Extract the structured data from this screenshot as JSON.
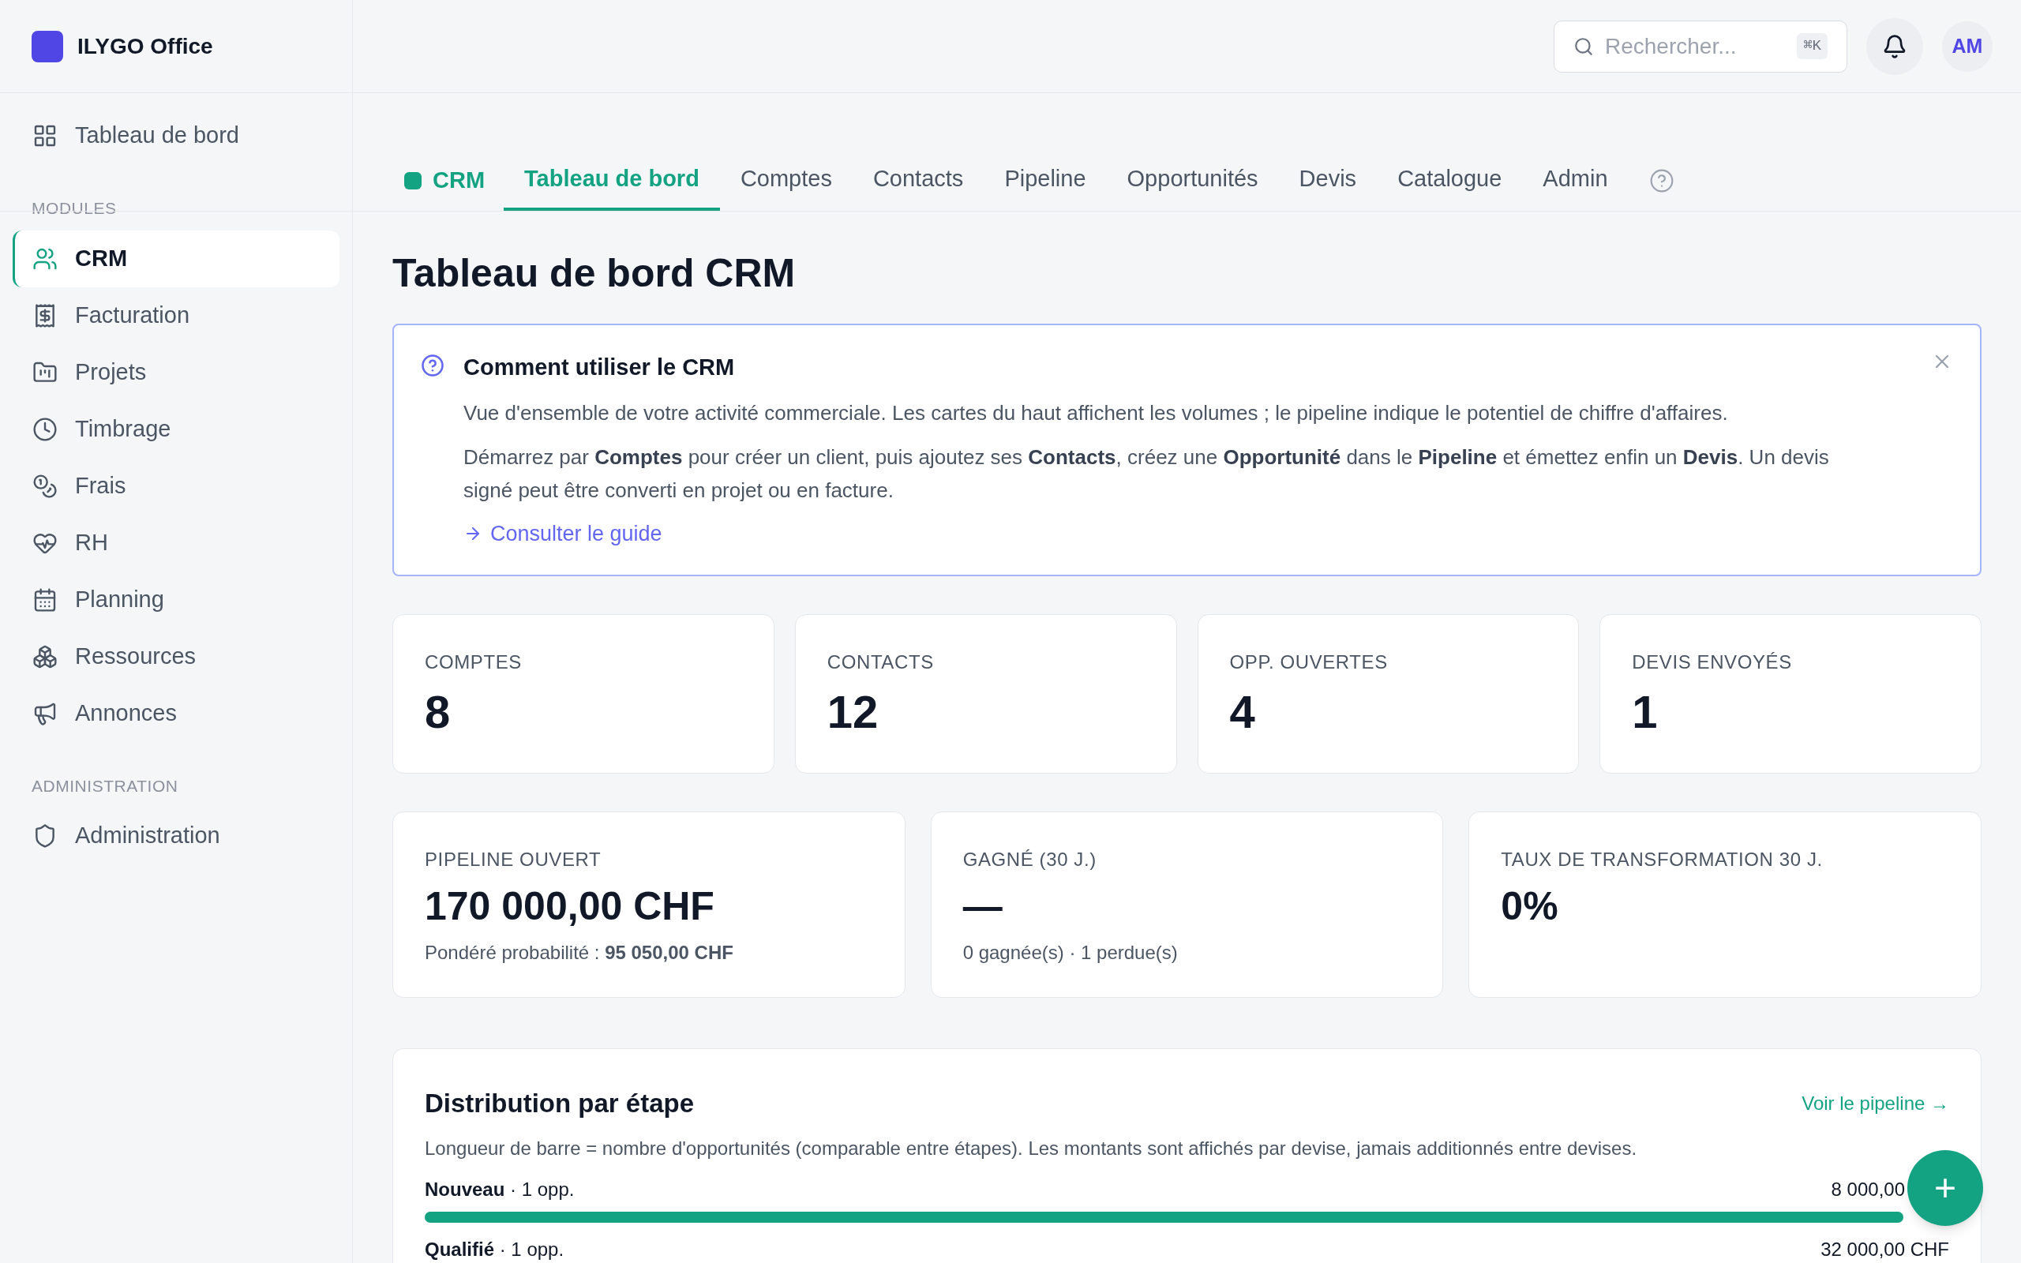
{
  "sidebar": {
    "brand": "ILYGO Office",
    "sections": [
      {
        "items": [
          {
            "label": "Tableau de bord",
            "selected": false
          }
        ]
      },
      {
        "label": "MODULES",
        "items": [
          {
            "label": "CRM",
            "selected": true
          },
          {
            "label": "Facturation",
            "selected": false
          },
          {
            "label": "Projets",
            "selected": false
          },
          {
            "label": "Timbrage",
            "selected": false
          },
          {
            "label": "Frais",
            "selected": false
          },
          {
            "label": "RH",
            "selected": false
          },
          {
            "label": "Planning",
            "selected": false
          },
          {
            "label": "Ressources",
            "selected": false
          },
          {
            "label": "Annonces",
            "selected": false
          }
        ]
      },
      {
        "label": "ADMINISTRATION",
        "items": [
          {
            "label": "Administration",
            "selected": false
          }
        ]
      }
    ]
  },
  "header": {
    "search": {
      "placeholder": "Rechercher...",
      "shortcut": "⌘K"
    },
    "avatar": "AM"
  },
  "module_tabs": {
    "module": "CRM",
    "tabs": [
      {
        "label": "Tableau de bord",
        "selected": true
      },
      {
        "label": "Comptes",
        "selected": false
      },
      {
        "label": "Contacts",
        "selected": false
      },
      {
        "label": "Pipeline",
        "selected": false
      },
      {
        "label": "Opportunités",
        "selected": false
      },
      {
        "label": "Devis",
        "selected": false
      },
      {
        "label": "Catalogue",
        "selected": false
      },
      {
        "label": "Admin",
        "selected": false
      }
    ]
  },
  "page_title": "Tableau de bord CRM",
  "info": {
    "title": "Comment utiliser le CRM",
    "paragraphs": [
      "Vue d'ensemble de votre activité commerciale. Les cartes du haut affichent les volumes ; le pipeline indique le potentiel de chiffre d'affaires.",
      "Démarrez par **Comptes** pour créer un client, puis ajoutez ses **Contacts**, créez une **Opportunité** dans le **Pipeline** et émettez enfin un **Devis**. Un devis signé peut être converti en projet ou en facture."
    ],
    "link": "Consulter le guide"
  },
  "stats": [
    {
      "label": "COMPTES",
      "value": "8"
    },
    {
      "label": "CONTACTS",
      "value": "12"
    },
    {
      "label": "OPP. OUVERTES",
      "value": "4"
    },
    {
      "label": "DEVIS ENVOYÉS",
      "value": "1"
    }
  ],
  "kpis": [
    {
      "label": "PIPELINE OUVERT",
      "value": "170 000,00 CHF",
      "note": "Pondéré probabilité : **95 050,00 CHF**"
    },
    {
      "label": "GAGNÉ (30 J.)",
      "value": "—",
      "note": "0 gagnée(s) · 1 perdue(s)"
    },
    {
      "label": "TAUX DE TRANSFORMATION 30 J.",
      "value": "0%"
    }
  ],
  "distribution": {
    "title": "Distribution par étape",
    "link": "Voir le pipeline →",
    "description": "Longueur de barre = nombre d'opportunités (comparable entre étapes). Les montants sont affichés par devise, jamais additionnés entre devises.",
    "rows": [
      {
        "label": "**Nouveau** · 1 opp.",
        "amount": "8 000,00",
        "level": 1
      },
      {
        "label": "**Qualifié** · 1 opp.",
        "amount": "32 000,00 CHF"
      }
    ]
  },
  "fab": "+"
}
